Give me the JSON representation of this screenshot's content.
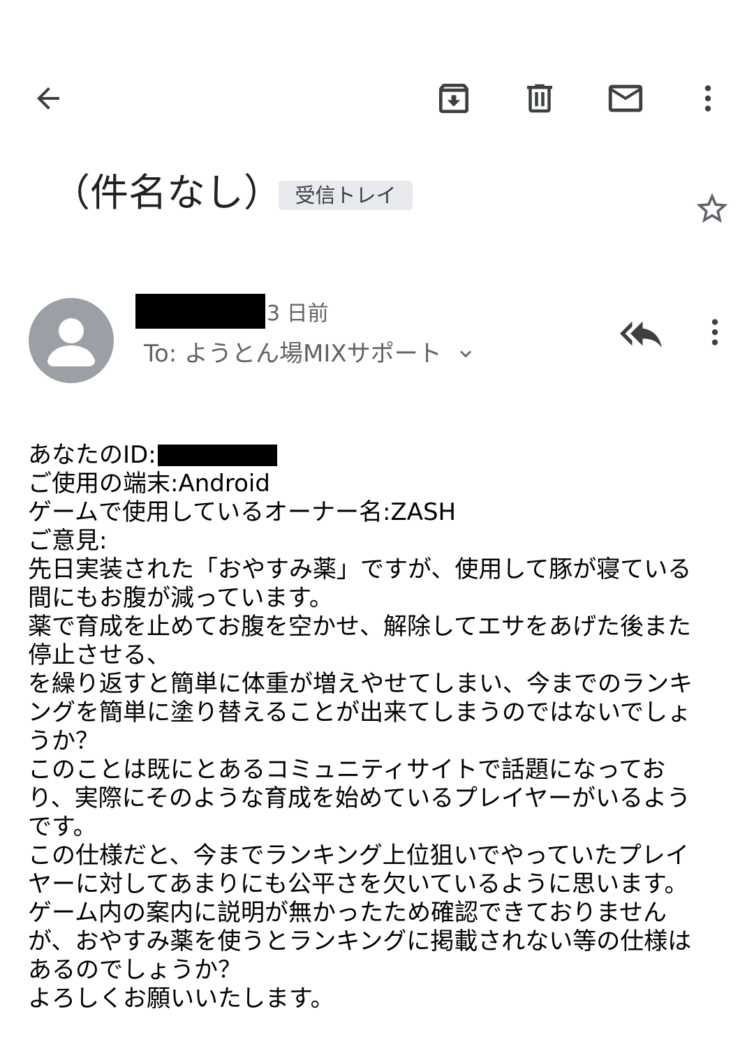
{
  "toolbar": {
    "back_icon": "arrow-back-icon",
    "archive_icon": "archive-icon",
    "delete_icon": "trash-icon",
    "mark_unread_icon": "mail-icon",
    "more_icon": "more-vert-icon"
  },
  "subject": {
    "title": "（件名なし）",
    "label": "受信トレイ",
    "star_icon": "star-outline-icon"
  },
  "message": {
    "time": "3 日前",
    "recipient": "To: ようとん場MIXサポート",
    "reply_all_icon": "reply-all-icon",
    "more_icon": "more-vert-icon"
  },
  "body": {
    "lines": [
      "あなたのID:",
      "ご使用の端末:Android",
      "ゲームで使用しているオーナー名:ZASH",
      "ご意見:",
      "先日実装された「おやすみ薬」ですが、使用して豚が寝ている",
      "間にもお腹が減っています。",
      "薬で育成を止めてお腹を空かせ、解除してエサをあげた後また",
      "停止させる、",
      "を繰り返すと簡単に体重が増えやせてしまい、今までのランキ",
      "ングを簡単に塗り替えることが出来てしまうのではないでしょ",
      "うか？",
      "このことは既にとあるコミュニティサイトで話題になってお",
      "り、実際にそのような育成を始めているプレイヤーがいるよう",
      "です。",
      "この仕様だと、今までランキング上位狙いでやっていたプレイ",
      "ヤーに対してあまりにも公平さを欠いているように思います。",
      "ゲーム内の案内に説明が無かったため確認できておりません",
      "が、おやすみ薬を使うとランキングに掲載されない等の仕様は",
      "あるのでしょうか？",
      "よろしくお願いいたします。"
    ]
  }
}
